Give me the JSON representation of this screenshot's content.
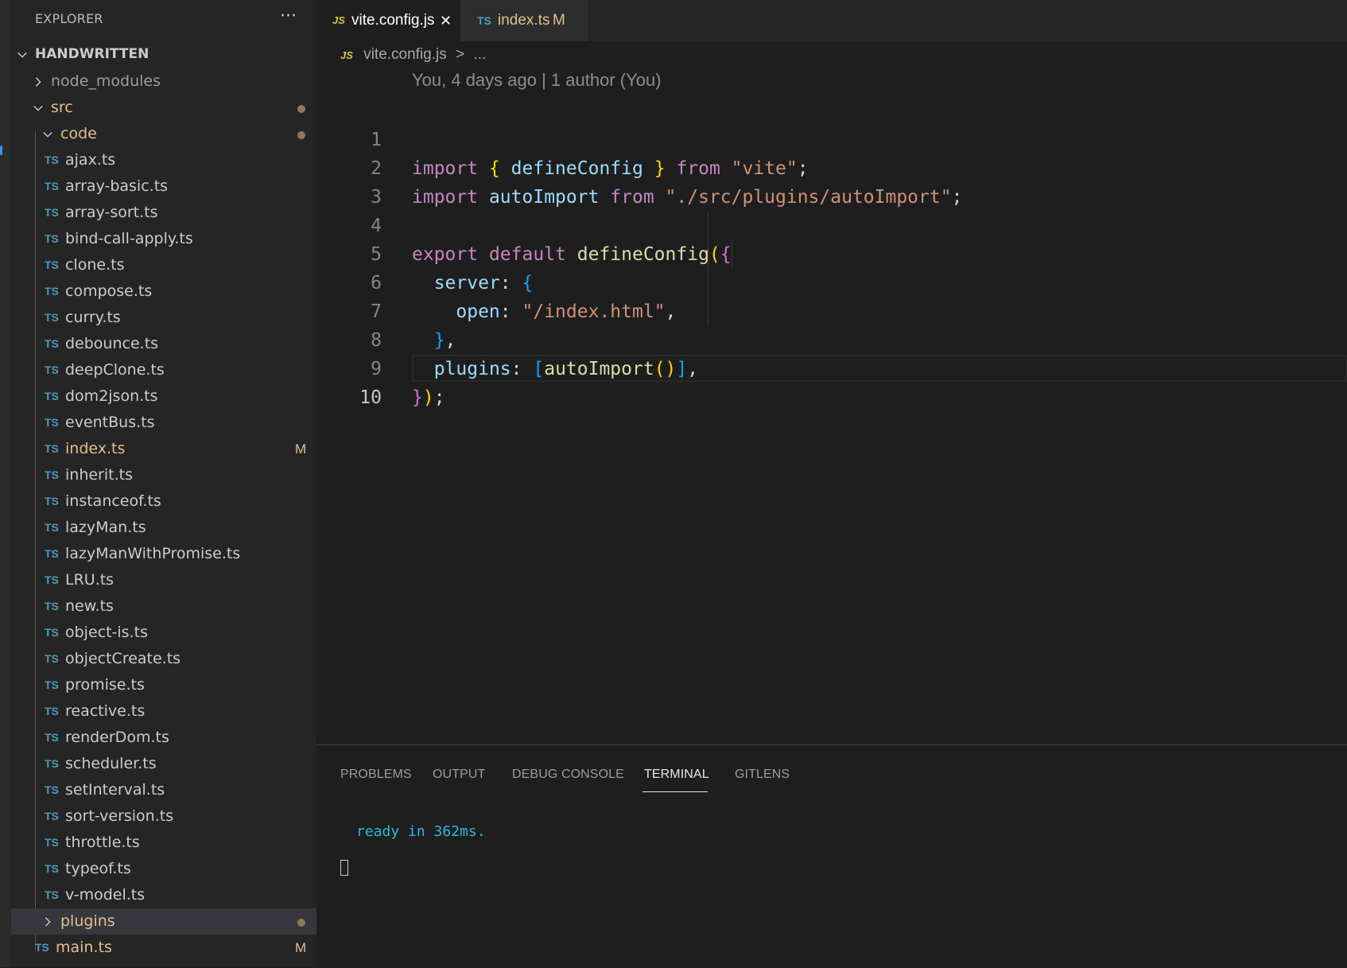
{
  "sidebar": {
    "title": "EXPLORER",
    "more": "···",
    "root": "HANDWRITTEN",
    "items": [
      {
        "label": "node_modules",
        "kind": "folder",
        "collapsed": true,
        "muted": true
      },
      {
        "label": "src",
        "kind": "folder",
        "collapsed": false,
        "dot": true
      },
      {
        "label": "code",
        "kind": "folder",
        "collapsed": false,
        "dot": true
      },
      {
        "label": "ajax.ts",
        "kind": "ts"
      },
      {
        "label": "array-basic.ts",
        "kind": "ts"
      },
      {
        "label": "array-sort.ts",
        "kind": "ts"
      },
      {
        "label": "bind-call-apply.ts",
        "kind": "ts"
      },
      {
        "label": "clone.ts",
        "kind": "ts"
      },
      {
        "label": "compose.ts",
        "kind": "ts"
      },
      {
        "label": "curry.ts",
        "kind": "ts"
      },
      {
        "label": "debounce.ts",
        "kind": "ts"
      },
      {
        "label": "deepClone.ts",
        "kind": "ts"
      },
      {
        "label": "dom2json.ts",
        "kind": "ts"
      },
      {
        "label": "eventBus.ts",
        "kind": "ts"
      },
      {
        "label": "index.ts",
        "kind": "ts",
        "modified": "M"
      },
      {
        "label": "inherit.ts",
        "kind": "ts"
      },
      {
        "label": "instanceof.ts",
        "kind": "ts"
      },
      {
        "label": "lazyMan.ts",
        "kind": "ts"
      },
      {
        "label": "lazyManWithPromise.ts",
        "kind": "ts"
      },
      {
        "label": "LRU.ts",
        "kind": "ts"
      },
      {
        "label": "new.ts",
        "kind": "ts"
      },
      {
        "label": "object-is.ts",
        "kind": "ts"
      },
      {
        "label": "objectCreate.ts",
        "kind": "ts"
      },
      {
        "label": "promise.ts",
        "kind": "ts"
      },
      {
        "label": "reactive.ts",
        "kind": "ts"
      },
      {
        "label": "renderDom.ts",
        "kind": "ts"
      },
      {
        "label": "scheduler.ts",
        "kind": "ts"
      },
      {
        "label": "setInterval.ts",
        "kind": "ts"
      },
      {
        "label": "sort-version.ts",
        "kind": "ts"
      },
      {
        "label": "throttle.ts",
        "kind": "ts"
      },
      {
        "label": "typeof.ts",
        "kind": "ts"
      },
      {
        "label": "v-model.ts",
        "kind": "ts"
      },
      {
        "label": "plugins",
        "kind": "folder",
        "collapsed": true,
        "dot": true,
        "selected": true
      },
      {
        "label": "main.ts",
        "kind": "ts",
        "modified": "M"
      }
    ]
  },
  "tabs": [
    {
      "badge": "JS",
      "label": "vite.config.js",
      "close": "✕",
      "active": true
    },
    {
      "badge": "TS",
      "label": "index.ts",
      "status": "M",
      "active": false
    }
  ],
  "breadcrumb": {
    "badge": "JS",
    "file": "vite.config.js",
    "sep": ">",
    "rest": "..."
  },
  "editor": {
    "blame": "You, 4 days ago | 1 author (You)",
    "line_numbers": [
      "1",
      "2",
      "3",
      "4",
      "5",
      "6",
      "7",
      "8",
      "9",
      "10"
    ],
    "current_line": "10"
  },
  "panel": {
    "tabs": [
      "PROBLEMS",
      "OUTPUT",
      "DEBUG CONSOLE",
      "TERMINAL",
      "GITLENS"
    ],
    "active_tab": "TERMINAL",
    "terminal_output": "ready in 362ms."
  },
  "colors": {
    "ts_icon": "#519aba",
    "js_icon": "#cbcb41",
    "modified": "#e2c08d",
    "keyword": "#c586c0",
    "string": "#ce9178",
    "variable": "#9cdcfe",
    "function": "#dcdcaa",
    "terminal_text": "#29b8db"
  }
}
